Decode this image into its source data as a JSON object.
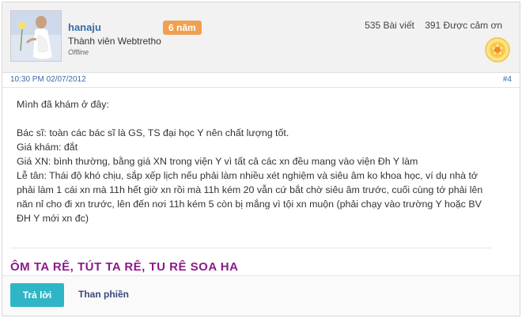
{
  "user": {
    "name": "hanaju",
    "badge": "6 năm",
    "role": "Thành viên Webtretho",
    "status": "Offline",
    "posts": "535 Bài viết",
    "thanks": "391 Được cảm ơn"
  },
  "post": {
    "timestamp": "10:30 PM 02/07/2012",
    "number": "#4",
    "lines": [
      "Mình đã khám ở đây:",
      "",
      "Bác sĩ: toàn các bác sĩ là GS, TS đại học Y nên chất lượng tốt.",
      "Giá khám: đắt",
      "Giá XN: bình thường, bằng giá XN trong viện Y vì tất cả các xn đều mang vào viện Đh Y làm",
      "Lễ tân: Thái độ khó chịu, sắp xếp lịch nếu phải làm nhiều xét nghiệm và siêu âm ko khoa học, ví dụ nhà tớ",
      "phải làm 1 cái xn mà 11h hết giờ xn rồi mà 11h kém 20 vẫn cứ bắt chờ siêu âm trước, cuối cùng tớ phải lên",
      "năn nỉ cho đi xn trước, lên đến nơi 11h kém 5 còn bị mắng vì tội xn muộn (phải chạy vào trường Y hoặc BV",
      "ĐH Y mới xn đc)"
    ],
    "signature": "ÔM TA RÊ, TÚT TA RÊ, TU RÊ SOA HA"
  },
  "actions": {
    "reply": "Trả lời",
    "complain": "Than phiền"
  },
  "icons": {
    "medal": "medal-icon",
    "avatar": "avatar"
  },
  "colors": {
    "reply_button": "#2fb6c6",
    "badge": "#f0a050",
    "signature": "#8a1a8a",
    "username": "#3a6aa8"
  }
}
